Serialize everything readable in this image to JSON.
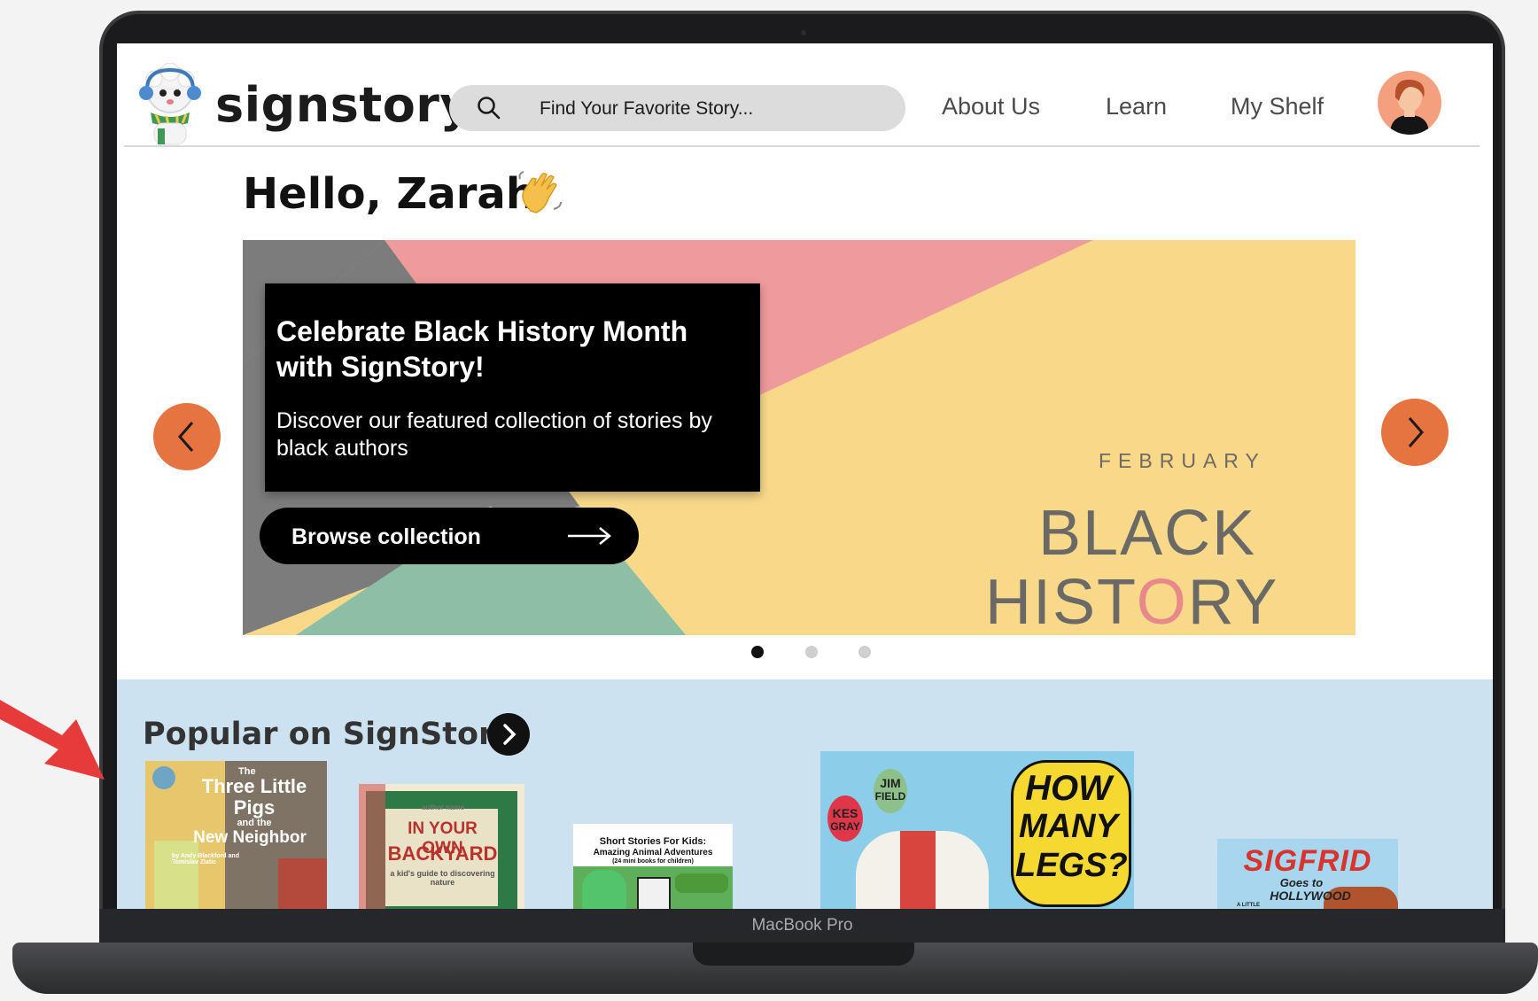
{
  "device": {
    "label": "MacBook Pro"
  },
  "header": {
    "logo_text": "signstory",
    "search_placeholder": "Find Your Favorite Story...",
    "nav": [
      "About Us",
      "Learn",
      "My Shelf"
    ]
  },
  "greeting": "Hello, Zarah",
  "hero": {
    "title": "Celebrate Black History Month with SignStory!",
    "description": "Discover our featured collection of stories by black authors",
    "button_label": "Browse collection",
    "banner_month": "FEBRUARY",
    "banner_line1": "BLACK",
    "banner_line2_a": "HIST",
    "banner_line2_o": "O",
    "banner_line2_b": "RY",
    "active_slide": 1,
    "slide_count": 3
  },
  "popular": {
    "title": "Popular on SignStory",
    "books": [
      {
        "line1": "The",
        "line2": "Three Little",
        "line3": "Pigs",
        "line4": "and the",
        "line5": "New Neighbor",
        "line6": "by Andy Blackford and Tomislav Zlatic"
      },
      {
        "line1": "author name",
        "line2": "IN YOUR OWN",
        "line3": "BACKYARD",
        "line4": "a kid's guide to discovering nature"
      },
      {
        "line1": "Short Stories For Kids:",
        "line2": "Amazing Animal Adventures",
        "line3": "(24 mini books for children)"
      },
      {
        "line1": "JIM",
        "line2": "FIELD",
        "line3": "KES",
        "line4": "GRAY",
        "line5": "HOW",
        "line6": "MANY",
        "line7": "LEGS?"
      },
      {
        "line1": "SIGFRID",
        "line2": "Goes to",
        "line3": "HOLLYWOOD",
        "line4": "A LITTLE"
      }
    ]
  },
  "colors": {
    "accent_orange": "#e57440",
    "popular_bg": "#cde2f1",
    "banner_pink": "#ef9b9b",
    "banner_yellow": "#f8d98a",
    "banner_green": "#8cbfa5",
    "banner_grey": "#7c7c7c"
  }
}
